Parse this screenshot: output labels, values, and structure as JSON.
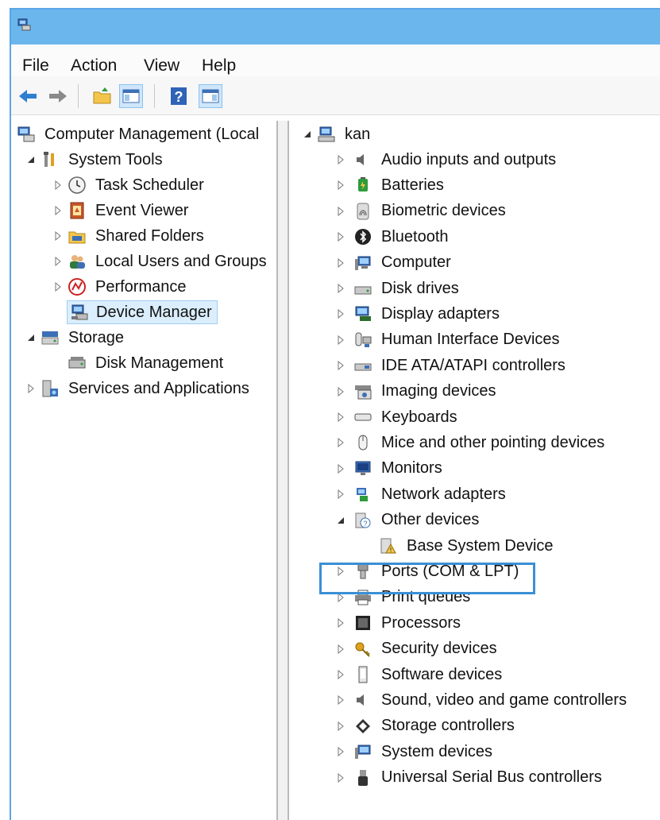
{
  "menubar": {
    "items": [
      "File",
      "Action",
      "View",
      "Help"
    ]
  },
  "toolbar": {
    "buttons": [
      "back-arrow-icon",
      "forward-arrow-icon",
      "up-folder-icon",
      "show-hide-console-tree-icon",
      "help-icon",
      "show-hide-action-pane-icon"
    ]
  },
  "left_tree": {
    "items": [
      {
        "label": "Computer Management (Local",
        "level": 0,
        "expander": "none",
        "icon": "computer-management-icon"
      },
      {
        "label": "System Tools",
        "level": 1,
        "expander": "expanded",
        "icon": "system-tools-icon"
      },
      {
        "label": "Task Scheduler",
        "level": 2,
        "expander": "collapsed",
        "icon": "clock-icon"
      },
      {
        "label": "Event Viewer",
        "level": 2,
        "expander": "collapsed",
        "icon": "event-viewer-icon"
      },
      {
        "label": "Shared Folders",
        "level": 2,
        "expander": "collapsed",
        "icon": "shared-folder-icon"
      },
      {
        "label": "Local Users and Groups",
        "level": 2,
        "expander": "collapsed",
        "icon": "users-icon"
      },
      {
        "label": "Performance",
        "level": 2,
        "expander": "collapsed",
        "icon": "performance-icon"
      },
      {
        "label": "Device Manager",
        "level": 2,
        "expander": "none",
        "icon": "device-manager-icon",
        "selected": true
      },
      {
        "label": "Storage",
        "level": 1,
        "expander": "expanded",
        "icon": "storage-icon"
      },
      {
        "label": "Disk Management",
        "level": 2,
        "expander": "none",
        "icon": "disk-management-icon"
      },
      {
        "label": "Services and Applications",
        "level": 1,
        "expander": "collapsed",
        "icon": "services-icon"
      }
    ]
  },
  "device_tree": {
    "root": {
      "label": "kan",
      "icon": "computer-icon"
    },
    "items": [
      {
        "label": "Audio inputs and outputs",
        "icon": "speaker-icon",
        "expander": "collapsed"
      },
      {
        "label": "Batteries",
        "icon": "battery-icon",
        "expander": "collapsed"
      },
      {
        "label": "Biometric devices",
        "icon": "fingerprint-icon",
        "expander": "collapsed"
      },
      {
        "label": "Bluetooth",
        "icon": "bluetooth-icon",
        "expander": "collapsed"
      },
      {
        "label": "Computer",
        "icon": "monitor-computer-icon",
        "expander": "collapsed"
      },
      {
        "label": "Disk drives",
        "icon": "disk-drive-icon",
        "expander": "collapsed"
      },
      {
        "label": "Display adapters",
        "icon": "display-adapter-icon",
        "expander": "collapsed"
      },
      {
        "label": "Human Interface Devices",
        "icon": "hid-icon",
        "expander": "collapsed"
      },
      {
        "label": "IDE ATA/ATAPI controllers",
        "icon": "ide-controller-icon",
        "expander": "collapsed"
      },
      {
        "label": "Imaging devices",
        "icon": "camera-icon",
        "expander": "collapsed"
      },
      {
        "label": "Keyboards",
        "icon": "keyboard-icon",
        "expander": "collapsed"
      },
      {
        "label": "Mice and other pointing devices",
        "icon": "mouse-icon",
        "expander": "collapsed"
      },
      {
        "label": "Monitors",
        "icon": "monitor-icon",
        "expander": "collapsed"
      },
      {
        "label": "Network adapters",
        "icon": "network-adapter-icon",
        "expander": "collapsed"
      },
      {
        "label": "Other devices",
        "icon": "unknown-device-icon",
        "expander": "expanded"
      },
      {
        "label": "Base System Device",
        "icon": "warning-device-icon",
        "expander": "none",
        "child": true
      },
      {
        "label": "Ports (COM & LPT)",
        "icon": "port-icon",
        "expander": "collapsed",
        "highlighted": true
      },
      {
        "label": "Print queues",
        "icon": "printer-icon",
        "expander": "collapsed"
      },
      {
        "label": "Processors",
        "icon": "processor-icon",
        "expander": "collapsed"
      },
      {
        "label": "Security devices",
        "icon": "key-icon",
        "expander": "collapsed"
      },
      {
        "label": "Software devices",
        "icon": "software-device-icon",
        "expander": "collapsed"
      },
      {
        "label": "Sound, video and game controllers",
        "icon": "speaker-icon",
        "expander": "collapsed"
      },
      {
        "label": "Storage controllers",
        "icon": "storage-controller-icon",
        "expander": "collapsed"
      },
      {
        "label": "System devices",
        "icon": "system-device-icon",
        "expander": "collapsed"
      },
      {
        "label": "Universal Serial Bus controllers",
        "icon": "usb-icon",
        "expander": "collapsed"
      }
    ]
  },
  "colors": {
    "titlebar": "#6cb6ee",
    "selection": "#dbeefd",
    "highlight_border": "#3a8fd6"
  }
}
